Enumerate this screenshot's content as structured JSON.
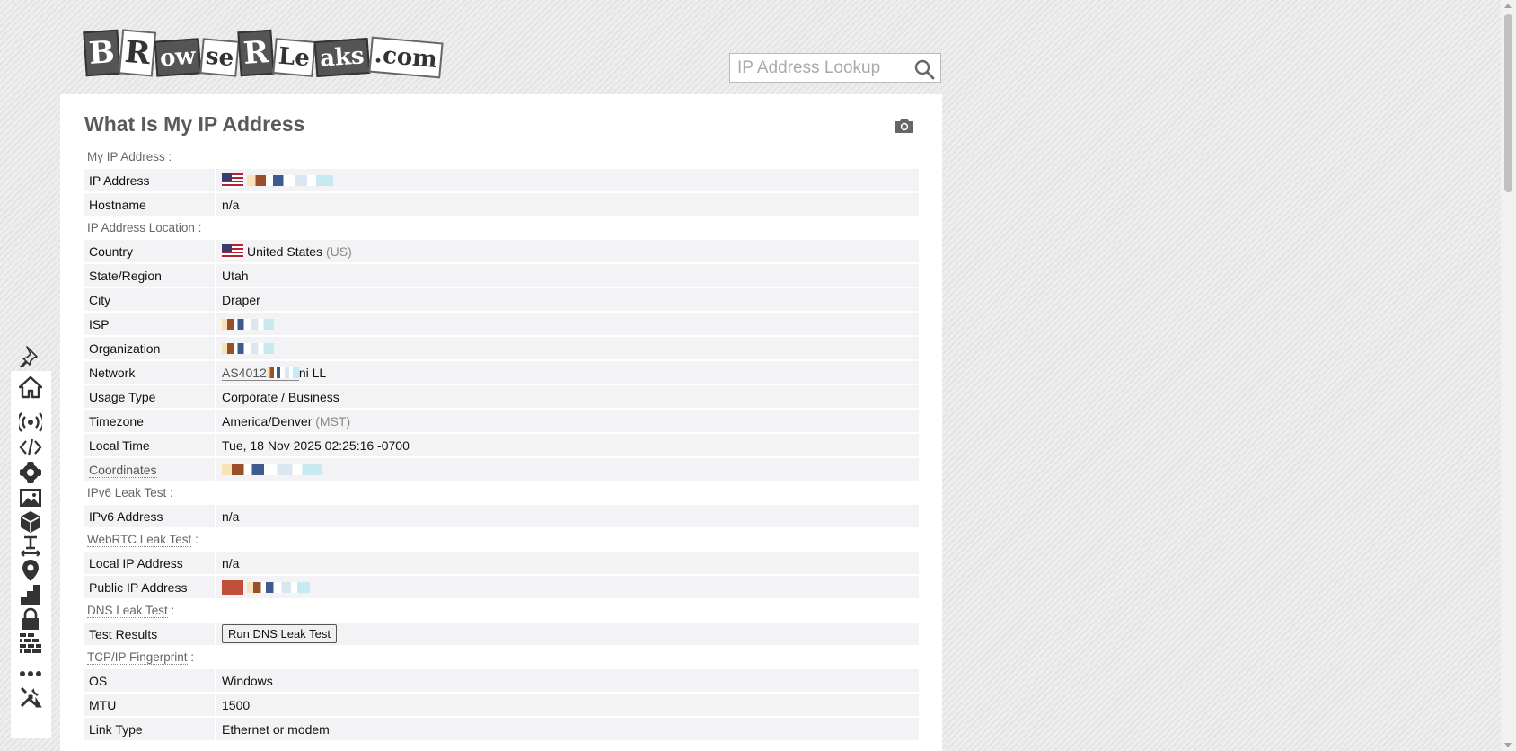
{
  "site": {
    "logo_text": "BrowserLeaks.com"
  },
  "search": {
    "placeholder": "IP Address Lookup"
  },
  "page": {
    "title": "What Is My IP Address"
  },
  "sections": {
    "my_ip": "My IP Address :",
    "location": "IP Address Location :",
    "ipv6": "IPv6 Leak Test :",
    "webrtc": "WebRTC Leak Test",
    "dns": "DNS Leak Test",
    "tcpip": "TCP/IP Fingerprint",
    "colon": " :"
  },
  "my_ip": {
    "ip_label": "IP Address",
    "hostname_label": "Hostname",
    "hostname_value": "n/a"
  },
  "location": {
    "country_label": "Country",
    "country_value": "United States",
    "country_code": "(US)",
    "state_label": "State/Region",
    "state_value": "Utah",
    "city_label": "City",
    "city_value": "Draper",
    "isp_label": "ISP",
    "org_label": "Organization",
    "network_label": "Network",
    "network_value": "AS4012",
    "network_suffix": "ni LL",
    "usage_label": "Usage Type",
    "usage_value": "Corporate / Business",
    "timezone_label": "Timezone",
    "timezone_value": "America/Denver",
    "timezone_abbr": "(MST)",
    "localtime_label": "Local Time",
    "localtime_value": "Tue, 18 Nov 2025 02:25:16 -0700",
    "coords_label": "Coordinates"
  },
  "ipv6": {
    "label": "IPv6 Address",
    "value": "n/a"
  },
  "webrtc": {
    "local_label": "Local IP Address",
    "local_value": "n/a",
    "public_label": "Public IP Address"
  },
  "dns": {
    "label": "Test Results",
    "button": "Run DNS Leak Test"
  },
  "tcpip": {
    "os_label": "OS",
    "os_value": "Windows",
    "mtu_label": "MTU",
    "mtu_value": "1500",
    "link_label": "Link Type",
    "link_value": "Ethernet or modem"
  },
  "sidebar_icons": [
    "pin-icon",
    "home-icon",
    "broadcast-icon",
    "code-icon",
    "flower-icon",
    "image-icon",
    "cube-icon",
    "text-height-icon",
    "location-icon",
    "chart-steps-icon",
    "lock-icon",
    "firewall-icon",
    "more-icon",
    "tools-icon"
  ],
  "colors": {
    "accent": "#5a5a5a",
    "row_bg": "#f3f3f5",
    "section_text": "#666666"
  }
}
